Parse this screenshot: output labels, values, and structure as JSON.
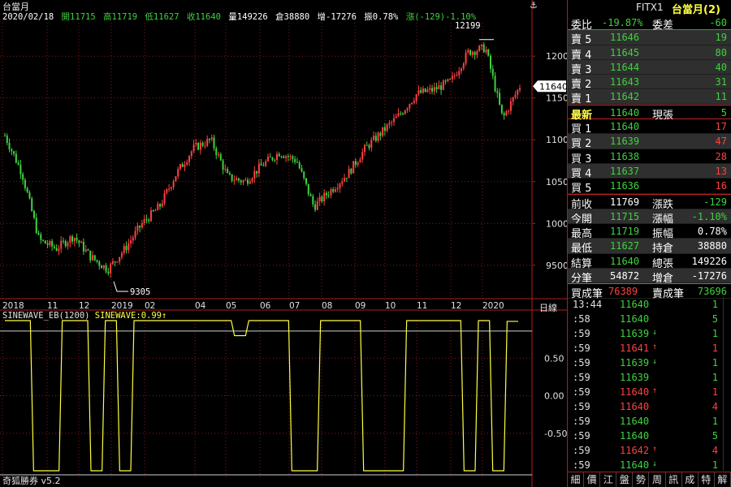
{
  "chart": {
    "title": "台當月",
    "header": {
      "date": "2020/02/18",
      "open": "開11715",
      "high": "高11719",
      "low": "低11627",
      "close": "收11640",
      "volume": "量149226",
      "oi": "倉38880",
      "oi_change": "增-17276",
      "amplitude": "振0.78%",
      "change": "漲(-129)-1.10%"
    },
    "high_marker": "12199",
    "low_marker": "9305",
    "last_price_tag": "11640",
    "period_label": "日線",
    "oscillator_label": "SINEWAVE_EB(1200)",
    "oscillator_value": "SINEWAVE:0.99",
    "footer": "奇狐勝券 v5.2",
    "anchor": "⚓",
    "colors": {
      "up": "#3fd23f",
      "down": "#ff4040",
      "grid": "#8b1a1a",
      "sine": "#ffff40"
    }
  },
  "chart_data": [
    {
      "type": "line",
      "title": "台當月",
      "xlabel": "",
      "ylabel": "",
      "x_ticks": [
        "2018",
        "11",
        "12",
        "2019",
        "02",
        "04",
        "05",
        "06",
        "07",
        "08",
        "09",
        "10",
        "11",
        "12",
        "2020"
      ],
      "y_ticks": [
        9500,
        10000,
        10500,
        11000,
        11500,
        12000
      ],
      "ylim": [
        9100,
        12400
      ],
      "series": [
        {
          "name": "",
          "x": [
            "2018-10",
            "2018-10b",
            "2018-11",
            "2018-11b",
            "2018-12",
            "2018-12b",
            "2019-01",
            "2019-01b",
            "2019-02",
            "2019-03",
            "2019-04",
            "2019-04b",
            "2019-05",
            "2019-05b",
            "2019-06",
            "2019-06b",
            "2019-07",
            "2019-07b",
            "2019-08",
            "2019-08b",
            "2019-09",
            "2019-09b",
            "2019-10",
            "2019-10b",
            "2019-11",
            "2019-11b",
            "2019-12",
            "2019-12b",
            "2020-01",
            "2020-01b",
            "2020-02"
          ],
          "values": [
            11050,
            10600,
            9800,
            9700,
            9850,
            9600,
            9450,
            9700,
            10000,
            10200,
            10600,
            10900,
            11000,
            10550,
            10500,
            10700,
            10850,
            10750,
            10200,
            10400,
            10600,
            10900,
            11100,
            11300,
            11550,
            11600,
            11700,
            12050,
            12100,
            11250,
            11640
          ]
        }
      ],
      "annotations": [
        "12199",
        "9305",
        "11640"
      ]
    },
    {
      "type": "line",
      "title": "SINEWAVE_EB(1200)",
      "y_ticks": [
        -0.5,
        0.0,
        0.5
      ],
      "ylim": [
        -1.0,
        1.0
      ],
      "series": [
        {
          "name": "SINEWAVE",
          "values": [
            1,
            1,
            -1,
            -1,
            1,
            1,
            -1,
            1,
            -1,
            1,
            1,
            1,
            1,
            1,
            1,
            1,
            0.8,
            1,
            1,
            1,
            -1,
            -1,
            1,
            1,
            1,
            -1,
            -1,
            -1,
            1,
            1,
            1,
            1,
            -1,
            1,
            -1,
            0.99
          ]
        }
      ]
    }
  ],
  "quote": {
    "code": "FITX1",
    "name": "台當月(2)",
    "ratio": {
      "label1": "委比",
      "value1": "-19.87%",
      "label2": "委差",
      "value2": "-60"
    },
    "asks": [
      {
        "label": "賣 5",
        "price": "11646",
        "qty": "19"
      },
      {
        "label": "賣 4",
        "price": "11645",
        "qty": "80"
      },
      {
        "label": "賣 3",
        "price": "11644",
        "qty": "40"
      },
      {
        "label": "賣 2",
        "price": "11643",
        "qty": "31"
      },
      {
        "label": "賣 1",
        "price": "11642",
        "qty": "11"
      }
    ],
    "last": {
      "label": "最新",
      "price": "11640",
      "label2": "現張",
      "qty": "5"
    },
    "bids": [
      {
        "label": "買 1",
        "price": "11640",
        "qty": "17"
      },
      {
        "label": "買 2",
        "price": "11639",
        "qty": "47"
      },
      {
        "label": "買 3",
        "price": "11638",
        "qty": "28"
      },
      {
        "label": "買 4",
        "price": "11637",
        "qty": "13"
      },
      {
        "label": "買 5",
        "price": "11636",
        "qty": "16"
      }
    ],
    "stats": [
      {
        "l1": "前收",
        "v1": "11769",
        "l2": "漲跌",
        "v2": "-129",
        "c1": "#ffffff",
        "c2": "#3fd23f"
      },
      {
        "l1": "今開",
        "v1": "11715",
        "l2": "漲幅",
        "v2": "-1.10%",
        "c1": "#3fd23f",
        "c2": "#3fd23f"
      },
      {
        "l1": "最高",
        "v1": "11719",
        "l2": "振幅",
        "v2": "0.78%",
        "c1": "#3fd23f",
        "c2": "#ffffff"
      },
      {
        "l1": "最低",
        "v1": "11627",
        "l2": "持倉",
        "v2": "38880",
        "c1": "#3fd23f",
        "c2": "#ffffff"
      },
      {
        "l1": "結算",
        "v1": "11640",
        "l2": "總張",
        "v2": "149226",
        "c1": "#3fd23f",
        "c2": "#ffffff"
      },
      {
        "l1": "分筆",
        "v1": "54872",
        "l2": "增倉",
        "v2": "-17276",
        "c1": "#ffffff",
        "c2": "#ffffff"
      }
    ],
    "trade_count": {
      "l1": "買成筆",
      "v1": "76389",
      "l2": "賣成筆",
      "v2": "73696"
    },
    "ticks": [
      {
        "time": "13:44",
        "price": "11640",
        "arrow": "",
        "qty": "1",
        "color": "#3fd23f"
      },
      {
        "time": ":58",
        "price": "11640",
        "arrow": "",
        "qty": "5",
        "color": "#3fd23f"
      },
      {
        "time": ":59",
        "price": "11639",
        "arrow": "↓",
        "qty": "1",
        "color": "#3fd23f"
      },
      {
        "time": ":59",
        "price": "11641",
        "arrow": "↑",
        "qty": "1",
        "color": "#ff4040"
      },
      {
        "time": ":59",
        "price": "11639",
        "arrow": "↓",
        "qty": "1",
        "color": "#3fd23f"
      },
      {
        "time": ":59",
        "price": "11639",
        "arrow": "",
        "qty": "1",
        "color": "#3fd23f"
      },
      {
        "time": ":59",
        "price": "11640",
        "arrow": "↑",
        "qty": "1",
        "color": "#ff4040"
      },
      {
        "time": ":59",
        "price": "11640",
        "arrow": "",
        "qty": "4",
        "color": "#ff4040"
      },
      {
        "time": ":59",
        "price": "11640",
        "arrow": "",
        "qty": "1",
        "color": "#3fd23f"
      },
      {
        "time": ":59",
        "price": "11640",
        "arrow": "",
        "qty": "5",
        "color": "#3fd23f"
      },
      {
        "time": ":59",
        "price": "11642",
        "arrow": "↑",
        "qty": "4",
        "color": "#ff4040"
      },
      {
        "time": ":59",
        "price": "11640",
        "arrow": "↓",
        "qty": "1",
        "color": "#3fd23f"
      }
    ],
    "tabs": [
      "細",
      "價",
      "江",
      "盤",
      "勢",
      "周",
      "訊",
      "成",
      "特",
      "解"
    ]
  }
}
